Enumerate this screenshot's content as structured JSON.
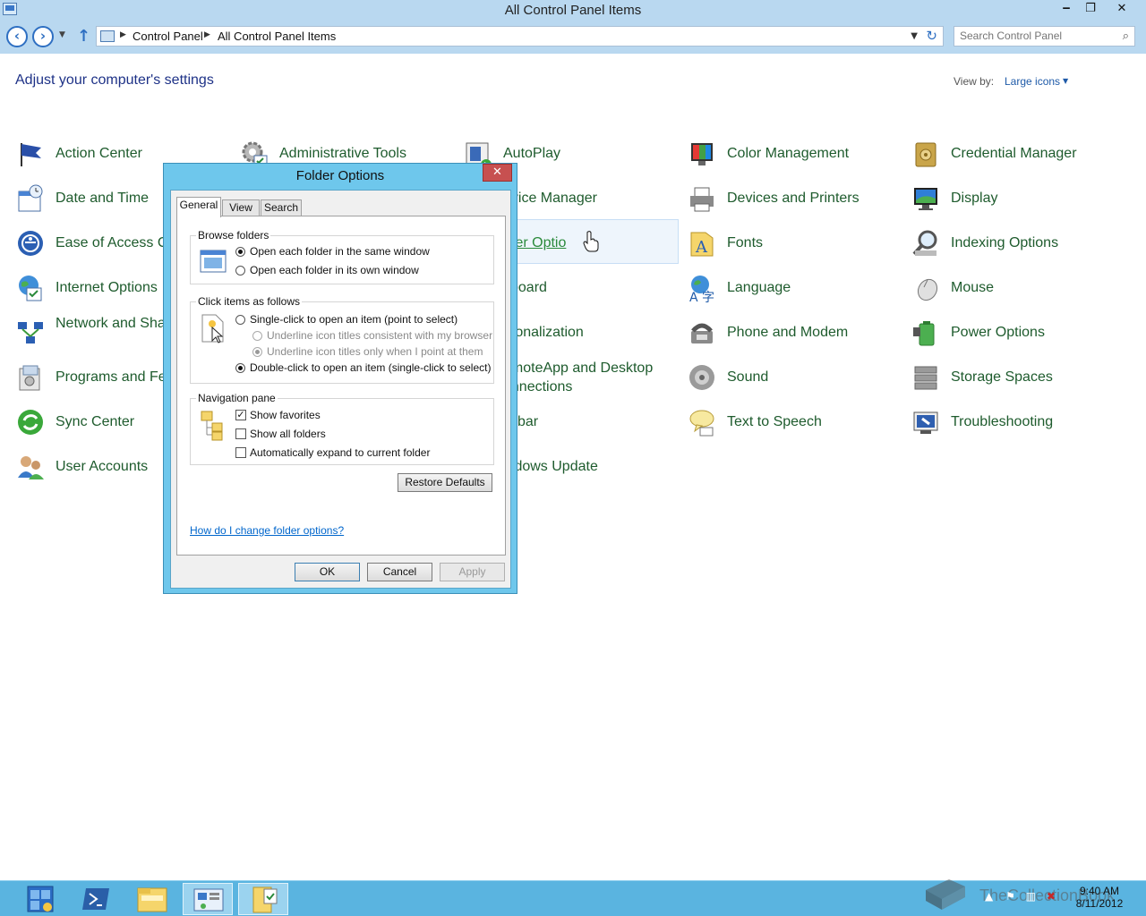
{
  "window": {
    "title": "All Control Panel Items",
    "minimize": "‒",
    "restore": "❐",
    "close": "✕"
  },
  "address": {
    "crumbs": [
      "Control Panel",
      "All Control Panel Items"
    ],
    "search_placeholder": "Search Control Panel"
  },
  "content": {
    "heading": "Adjust your computer's settings",
    "view_by_label": "View by:",
    "view_by_value": "Large icons"
  },
  "items": [
    {
      "label": "Action Center",
      "icon": "flag-icon"
    },
    {
      "label": "Date and Time",
      "icon": "clock-calendar-icon"
    },
    {
      "label": "Ease of Access Ce",
      "icon": "ease-of-access-icon"
    },
    {
      "label": "Internet Options",
      "icon": "globe-icon"
    },
    {
      "label": "Network and Sha Center",
      "icon": "network-icon"
    },
    {
      "label": "Programs and Fe",
      "icon": "programs-icon"
    },
    {
      "label": "Sync Center",
      "icon": "sync-icon"
    },
    {
      "label": "User Accounts",
      "icon": "users-icon"
    },
    {
      "label": "Administrative Tools",
      "icon": "gear-tools-icon"
    },
    {
      "label": "AutoPlay",
      "icon": "autoplay-icon"
    },
    {
      "label": "evice Manager",
      "icon": "device-manager-icon"
    },
    {
      "label": "lder Optio",
      "icon": "folder-options-icon"
    },
    {
      "label": "yboard",
      "icon": "keyboard-icon"
    },
    {
      "label": "rsonalization",
      "icon": "personalization-icon"
    },
    {
      "label": "emoteApp and Desktop onnections",
      "icon": "remoteapp-icon"
    },
    {
      "label": "skbar",
      "icon": "taskbar-icon"
    },
    {
      "label": "indows Update",
      "icon": "windows-update-icon"
    },
    {
      "label": "Color Management",
      "icon": "color-management-icon"
    },
    {
      "label": "Devices and Printers",
      "icon": "printer-icon"
    },
    {
      "label": "Fonts",
      "icon": "fonts-icon"
    },
    {
      "label": "Language",
      "icon": "language-icon"
    },
    {
      "label": "Phone and Modem",
      "icon": "phone-icon"
    },
    {
      "label": "Sound",
      "icon": "speaker-icon"
    },
    {
      "label": "Text to Speech",
      "icon": "speech-bubble-icon"
    },
    {
      "label": "Credential Manager",
      "icon": "vault-icon"
    },
    {
      "label": "Display",
      "icon": "monitor-icon"
    },
    {
      "label": "Indexing Options",
      "icon": "magnifier-icon"
    },
    {
      "label": "Mouse",
      "icon": "mouse-icon"
    },
    {
      "label": "Power Options",
      "icon": "battery-icon"
    },
    {
      "label": "Storage Spaces",
      "icon": "storage-icon"
    },
    {
      "label": "Troubleshooting",
      "icon": "troubleshoot-icon"
    }
  ],
  "dialog": {
    "title": "Folder Options",
    "close": "✕",
    "tabs": [
      "General",
      "View",
      "Search"
    ],
    "browse": {
      "title": "Browse folders",
      "same_window": "Open each folder in the same window",
      "own_window": "Open each folder in its own window"
    },
    "click": {
      "title": "Click items as follows",
      "single": "Single-click to open an item (point to select)",
      "underline_browser": "Underline icon titles consistent with my browser",
      "underline_point": "Underline icon titles only when I point at them",
      "double": "Double-click to open an item (single-click to select)"
    },
    "nav": {
      "title": "Navigation pane",
      "favorites": "Show favorites",
      "all_folders": "Show all folders",
      "expand": "Automatically expand to current folder"
    },
    "restore_defaults": "Restore Defaults",
    "help_link": "How do I change folder options?",
    "ok": "OK",
    "cancel": "Cancel",
    "apply": "Apply"
  },
  "taskbar": {
    "time": "9:40 AM",
    "date": "8/11/2012",
    "watermark": "TheCollectionBook"
  }
}
